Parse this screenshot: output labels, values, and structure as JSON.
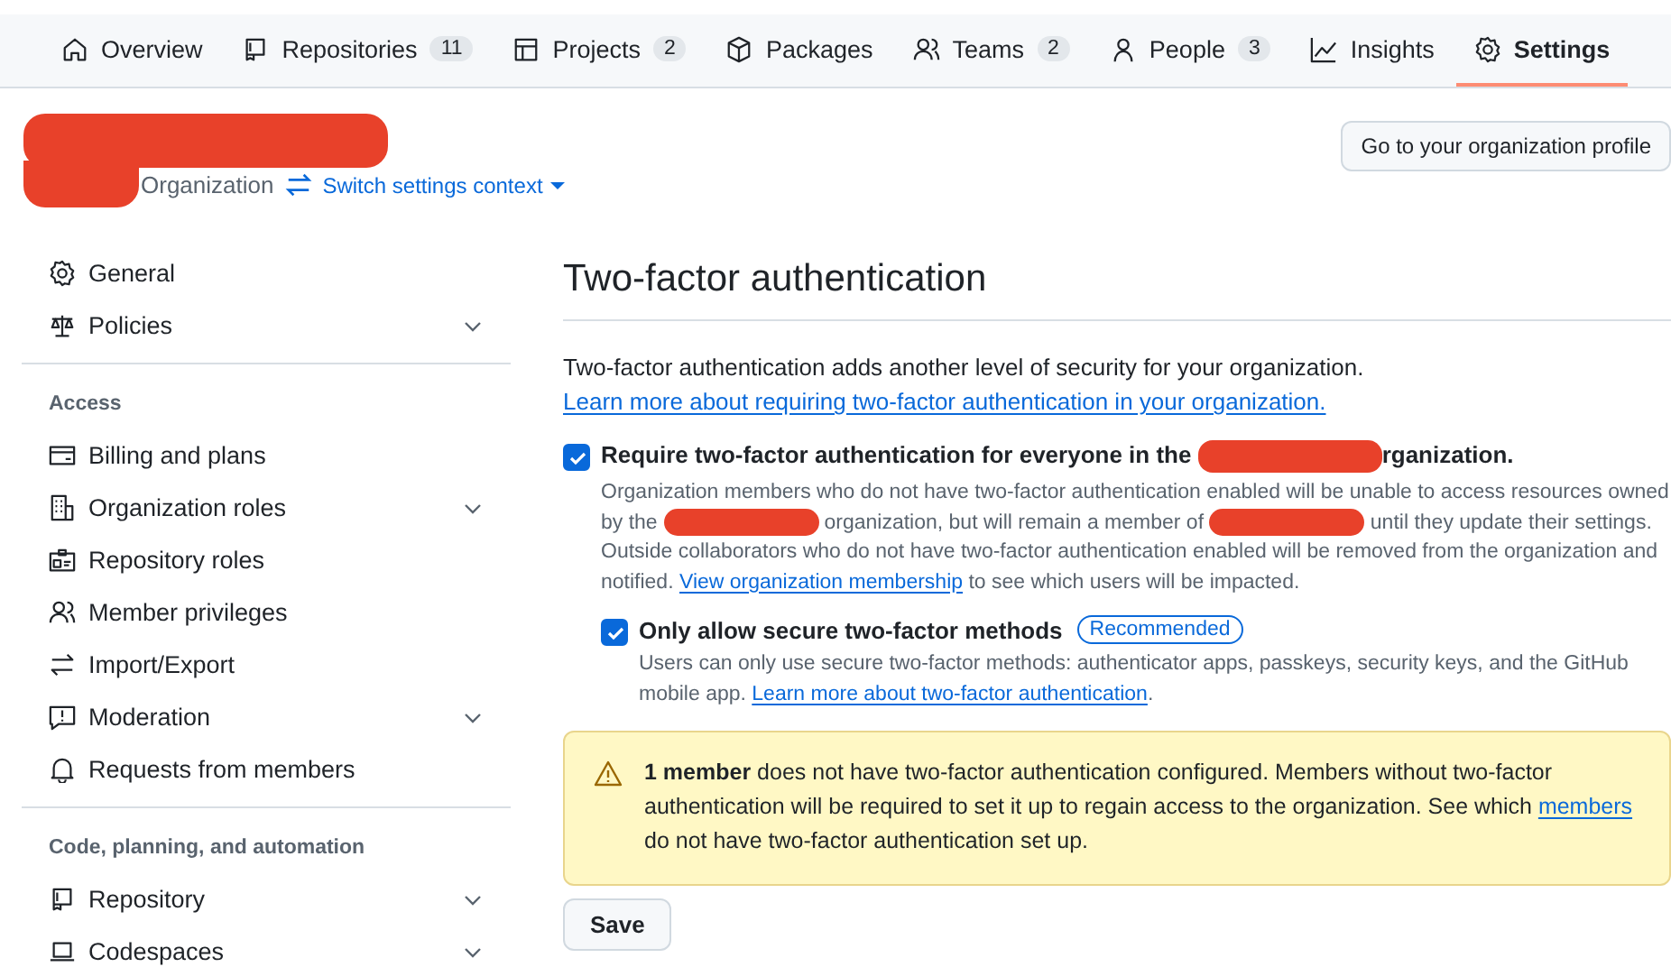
{
  "nav": [
    {
      "label": "Overview",
      "selected": false
    },
    {
      "label": "Repositories",
      "count": "11",
      "selected": false
    },
    {
      "label": "Projects",
      "count": "2",
      "selected": false
    },
    {
      "label": "Packages",
      "selected": false
    },
    {
      "label": "Teams",
      "count": "2",
      "selected": false
    },
    {
      "label": "People",
      "count": "3",
      "selected": false
    },
    {
      "label": "Insights",
      "selected": false
    },
    {
      "label": "Settings",
      "selected": true
    }
  ],
  "header": {
    "context_label": "Organization",
    "switch_link": "Switch settings context",
    "profile_button": "Go to your organization profile"
  },
  "sidebar": {
    "sections": [
      {
        "items": [
          {
            "label": "General",
            "expandable": false
          },
          {
            "label": "Policies",
            "expandable": true
          }
        ]
      },
      {
        "heading": "Access",
        "items": [
          {
            "label": "Billing and plans",
            "expandable": false
          },
          {
            "label": "Organization roles",
            "expandable": true
          },
          {
            "label": "Repository roles",
            "expandable": false
          },
          {
            "label": "Member privileges",
            "expandable": false
          },
          {
            "label": "Import/Export",
            "expandable": false
          },
          {
            "label": "Moderation",
            "expandable": true
          },
          {
            "label": "Requests from members",
            "expandable": false
          }
        ]
      },
      {
        "heading": "Code, planning, and automation",
        "items": [
          {
            "label": "Repository",
            "expandable": true
          },
          {
            "label": "Codespaces",
            "expandable": true
          }
        ]
      }
    ]
  },
  "main": {
    "title": "Two-factor authentication",
    "intro": [
      {
        "kind": "text",
        "text": "Two-factor authentication adds another level of security for your organization. "
      },
      {
        "kind": "link",
        "text": "Learn more about requiring two-factor authentication in your organization."
      }
    ],
    "options": [
      {
        "checked": true,
        "nested": false,
        "label": [
          {
            "kind": "text",
            "text": "Require two-factor authentication for everyone in the "
          },
          {
            "kind": "redacted"
          },
          {
            "kind": "text",
            "text": "rganization."
          }
        ],
        "description": [
          {
            "kind": "text",
            "text": "Organization members who do not have two-factor authentication enabled will be unable to access resources owned by the "
          },
          {
            "kind": "redacted"
          },
          {
            "kind": "text",
            "text": " organization, but will remain a member of "
          },
          {
            "kind": "redacted"
          },
          {
            "kind": "text",
            "text": " until they update their settings. Outside collaborators who do not have two-factor authentication enabled will be removed from the organization and notified. "
          },
          {
            "kind": "link",
            "text": "View organization membership"
          },
          {
            "kind": "text",
            "text": " to see which users will be impacted."
          }
        ]
      },
      {
        "checked": true,
        "nested": true,
        "label": [
          {
            "kind": "text",
            "text": "Only allow secure two-factor methods"
          }
        ],
        "badge": "Recommended",
        "description": [
          {
            "kind": "text",
            "text": "Users can only use secure two-factor methods: authenticator apps, passkeys, security keys, and the GitHub mobile app. "
          },
          {
            "kind": "link",
            "text": "Learn more about two-factor authentication"
          },
          {
            "kind": "text",
            "text": "."
          }
        ]
      }
    ],
    "warning": [
      {
        "kind": "bold",
        "text": "1 member"
      },
      {
        "kind": "text",
        "text": " does not have two-factor authentication configured. Members without two-factor authentication will be required to set it up to regain access to the organization. See which "
      },
      {
        "kind": "link",
        "text": "members"
      },
      {
        "kind": "text",
        "text": " do not have two-factor authentication set up."
      }
    ],
    "save_button": "Save"
  }
}
